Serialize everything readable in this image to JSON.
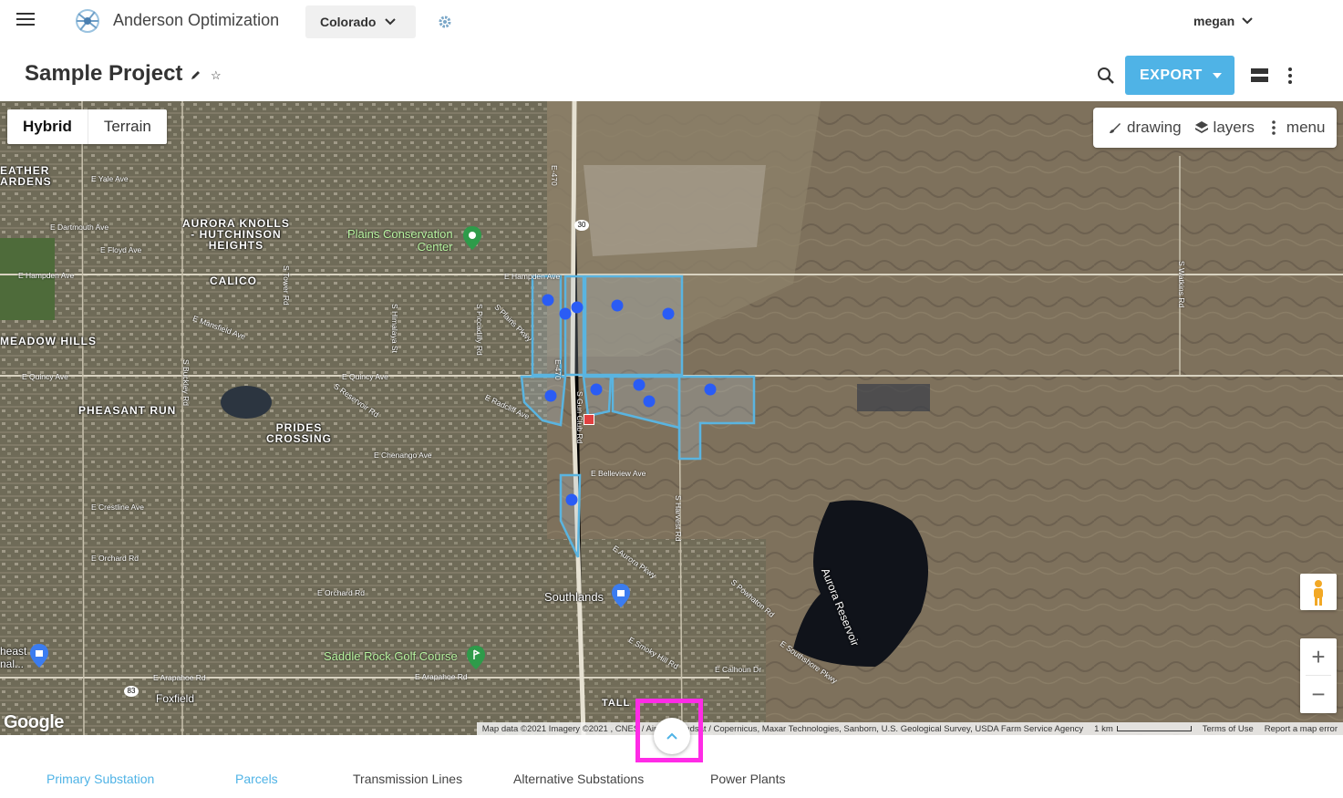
{
  "app": {
    "name": "Anderson Optimization"
  },
  "header": {
    "state": "Colorado",
    "user": "megan"
  },
  "project": {
    "title": "Sample Project"
  },
  "toolbar": {
    "export_label": "EXPORT"
  },
  "map": {
    "type_buttons": [
      "Hybrid",
      "Terrain"
    ],
    "selected_type": "Hybrid",
    "tools": {
      "drawing": "drawing",
      "layers": "layers",
      "menu": "menu"
    },
    "google_logo": "Google",
    "attribution": {
      "data": "Map data ©2021 Imagery ©2021 , CNES / Airbus, Landsat / Copernicus, Maxar Technologies, Sanborn, U.S. Geological Survey, USDA Farm Service Agency",
      "scale": "1 km",
      "terms": "Terms of Use",
      "report": "Report a map error"
    },
    "place_labels": {
      "aurora_knolls": "AURORA KNOLLS\n- HUTCHINSON\nHEIGHTS",
      "calico": "CALICO",
      "meadow_hills": "MEADOW HILLS",
      "pheasant_run": "PHEASANT RUN",
      "prides_crossing": "PRIDES\nCROSSING",
      "heather_gardens": "EATHER\nARDENS",
      "plains_center": "Plains Conservation\nCenter",
      "southlands": "Southlands",
      "saddle_rock": "Saddle Rock Golf Course",
      "foxfield": "Foxfield",
      "aurora_reservoir": "Aurora Reservoir",
      "tallyns": "TALL",
      "east_edge": "heast\nnal..."
    },
    "roads": [
      "E Hampden Ave",
      "E Quincy Ave",
      "E Chenango Ave",
      "E Belleview Ave",
      "E Orchard Rd",
      "E Arapahoe Rd",
      "E Smoky Hill Rd",
      "E Mansfield Ave",
      "E Dartmouth Ave",
      "E Yale Ave",
      "E Floyd Ave",
      "E Radcliff Ave",
      "E Crestline Ave",
      "E-470",
      "S Gun Club Rd",
      "S Harvest Rd",
      "S Watkins Rd",
      "S Piccadilly Rd",
      "S Tower Rd",
      "S Buckley Rd",
      "S Himalaya St",
      "E Calhoun Dr",
      "S Powhaton Rd",
      "E Southshore Pkwy",
      "E Aurora Pkwy",
      "S Reservoir Rd",
      "S Plains Pkwy"
    ],
    "route_shields": [
      "30",
      "83"
    ]
  },
  "bottom_tabs": [
    {
      "label": "Primary Substation"
    },
    {
      "label": "Parcels"
    },
    {
      "label": "Transmission Lines"
    },
    {
      "label": "Alternative Substations"
    },
    {
      "label": "Power Plants"
    }
  ],
  "colors": {
    "accent": "#4fb3e6",
    "highlight": "#ff2be6",
    "parcel_outline": "#5ab4e0",
    "marker": "#2a5cf5"
  }
}
